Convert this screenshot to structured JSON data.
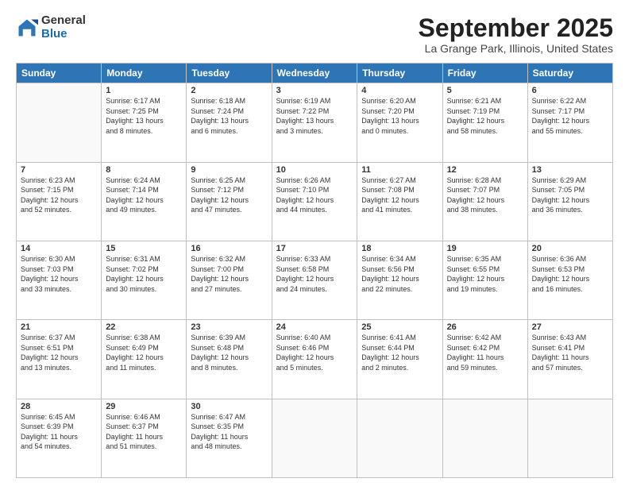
{
  "header": {
    "logo_general": "General",
    "logo_blue": "Blue",
    "month_title": "September 2025",
    "location": "La Grange Park, Illinois, United States"
  },
  "days_of_week": [
    "Sunday",
    "Monday",
    "Tuesday",
    "Wednesday",
    "Thursday",
    "Friday",
    "Saturday"
  ],
  "weeks": [
    [
      {
        "day": "",
        "info": ""
      },
      {
        "day": "1",
        "info": "Sunrise: 6:17 AM\nSunset: 7:25 PM\nDaylight: 13 hours\nand 8 minutes."
      },
      {
        "day": "2",
        "info": "Sunrise: 6:18 AM\nSunset: 7:24 PM\nDaylight: 13 hours\nand 6 minutes."
      },
      {
        "day": "3",
        "info": "Sunrise: 6:19 AM\nSunset: 7:22 PM\nDaylight: 13 hours\nand 3 minutes."
      },
      {
        "day": "4",
        "info": "Sunrise: 6:20 AM\nSunset: 7:20 PM\nDaylight: 13 hours\nand 0 minutes."
      },
      {
        "day": "5",
        "info": "Sunrise: 6:21 AM\nSunset: 7:19 PM\nDaylight: 12 hours\nand 58 minutes."
      },
      {
        "day": "6",
        "info": "Sunrise: 6:22 AM\nSunset: 7:17 PM\nDaylight: 12 hours\nand 55 minutes."
      }
    ],
    [
      {
        "day": "7",
        "info": "Sunrise: 6:23 AM\nSunset: 7:15 PM\nDaylight: 12 hours\nand 52 minutes."
      },
      {
        "day": "8",
        "info": "Sunrise: 6:24 AM\nSunset: 7:14 PM\nDaylight: 12 hours\nand 49 minutes."
      },
      {
        "day": "9",
        "info": "Sunrise: 6:25 AM\nSunset: 7:12 PM\nDaylight: 12 hours\nand 47 minutes."
      },
      {
        "day": "10",
        "info": "Sunrise: 6:26 AM\nSunset: 7:10 PM\nDaylight: 12 hours\nand 44 minutes."
      },
      {
        "day": "11",
        "info": "Sunrise: 6:27 AM\nSunset: 7:08 PM\nDaylight: 12 hours\nand 41 minutes."
      },
      {
        "day": "12",
        "info": "Sunrise: 6:28 AM\nSunset: 7:07 PM\nDaylight: 12 hours\nand 38 minutes."
      },
      {
        "day": "13",
        "info": "Sunrise: 6:29 AM\nSunset: 7:05 PM\nDaylight: 12 hours\nand 36 minutes."
      }
    ],
    [
      {
        "day": "14",
        "info": "Sunrise: 6:30 AM\nSunset: 7:03 PM\nDaylight: 12 hours\nand 33 minutes."
      },
      {
        "day": "15",
        "info": "Sunrise: 6:31 AM\nSunset: 7:02 PM\nDaylight: 12 hours\nand 30 minutes."
      },
      {
        "day": "16",
        "info": "Sunrise: 6:32 AM\nSunset: 7:00 PM\nDaylight: 12 hours\nand 27 minutes."
      },
      {
        "day": "17",
        "info": "Sunrise: 6:33 AM\nSunset: 6:58 PM\nDaylight: 12 hours\nand 24 minutes."
      },
      {
        "day": "18",
        "info": "Sunrise: 6:34 AM\nSunset: 6:56 PM\nDaylight: 12 hours\nand 22 minutes."
      },
      {
        "day": "19",
        "info": "Sunrise: 6:35 AM\nSunset: 6:55 PM\nDaylight: 12 hours\nand 19 minutes."
      },
      {
        "day": "20",
        "info": "Sunrise: 6:36 AM\nSunset: 6:53 PM\nDaylight: 12 hours\nand 16 minutes."
      }
    ],
    [
      {
        "day": "21",
        "info": "Sunrise: 6:37 AM\nSunset: 6:51 PM\nDaylight: 12 hours\nand 13 minutes."
      },
      {
        "day": "22",
        "info": "Sunrise: 6:38 AM\nSunset: 6:49 PM\nDaylight: 12 hours\nand 11 minutes."
      },
      {
        "day": "23",
        "info": "Sunrise: 6:39 AM\nSunset: 6:48 PM\nDaylight: 12 hours\nand 8 minutes."
      },
      {
        "day": "24",
        "info": "Sunrise: 6:40 AM\nSunset: 6:46 PM\nDaylight: 12 hours\nand 5 minutes."
      },
      {
        "day": "25",
        "info": "Sunrise: 6:41 AM\nSunset: 6:44 PM\nDaylight: 12 hours\nand 2 minutes."
      },
      {
        "day": "26",
        "info": "Sunrise: 6:42 AM\nSunset: 6:42 PM\nDaylight: 11 hours\nand 59 minutes."
      },
      {
        "day": "27",
        "info": "Sunrise: 6:43 AM\nSunset: 6:41 PM\nDaylight: 11 hours\nand 57 minutes."
      }
    ],
    [
      {
        "day": "28",
        "info": "Sunrise: 6:45 AM\nSunset: 6:39 PM\nDaylight: 11 hours\nand 54 minutes."
      },
      {
        "day": "29",
        "info": "Sunrise: 6:46 AM\nSunset: 6:37 PM\nDaylight: 11 hours\nand 51 minutes."
      },
      {
        "day": "30",
        "info": "Sunrise: 6:47 AM\nSunset: 6:35 PM\nDaylight: 11 hours\nand 48 minutes."
      },
      {
        "day": "",
        "info": ""
      },
      {
        "day": "",
        "info": ""
      },
      {
        "day": "",
        "info": ""
      },
      {
        "day": "",
        "info": ""
      }
    ]
  ]
}
